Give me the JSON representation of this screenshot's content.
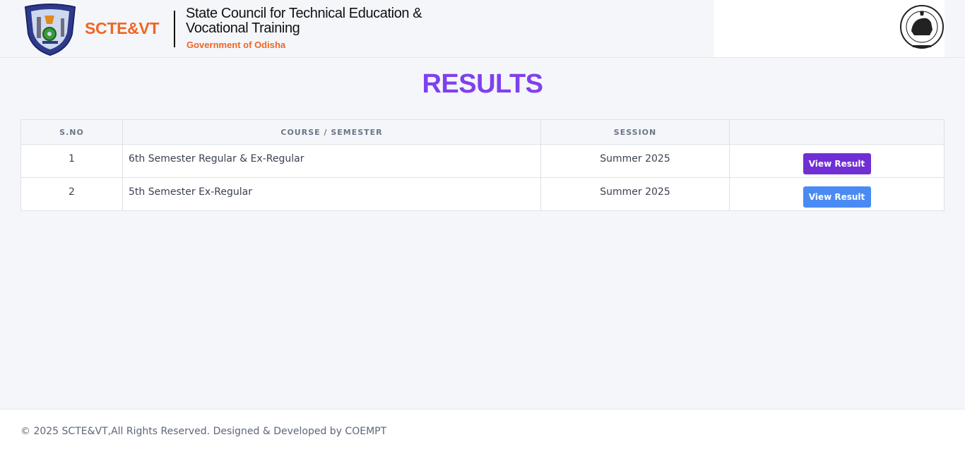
{
  "header": {
    "brand_short": "SCTE&VT",
    "brand_name_line1": "State Council for Technical Education &",
    "brand_name_line2": "Vocational Training",
    "brand_gov": "Government of Odisha",
    "emblem_icon": "scte-vt-emblem-icon",
    "state_emblem_icon": "odisha-state-emblem-icon"
  },
  "page": {
    "title": "RESULTS"
  },
  "table": {
    "headers": [
      "S.NO",
      "COURSE / SEMESTER",
      "SESSION",
      ""
    ],
    "rows": [
      {
        "sno": "1",
        "course": "6th Semester Regular & Ex-Regular",
        "session": "Summer 2025",
        "action": "View Result",
        "button_color": "#6f2fd4"
      },
      {
        "sno": "2",
        "course": "5th Semester Ex-Regular",
        "session": "Summer 2025",
        "action": "View Result",
        "button_color": "#4a8af4"
      }
    ]
  },
  "footer": {
    "text": "© 2025 SCTE&VT,All Rights Reserved. Designed & Developed by COEMPT"
  },
  "colors": {
    "accent": "#8040ef",
    "brand_orange": "#f26522"
  }
}
